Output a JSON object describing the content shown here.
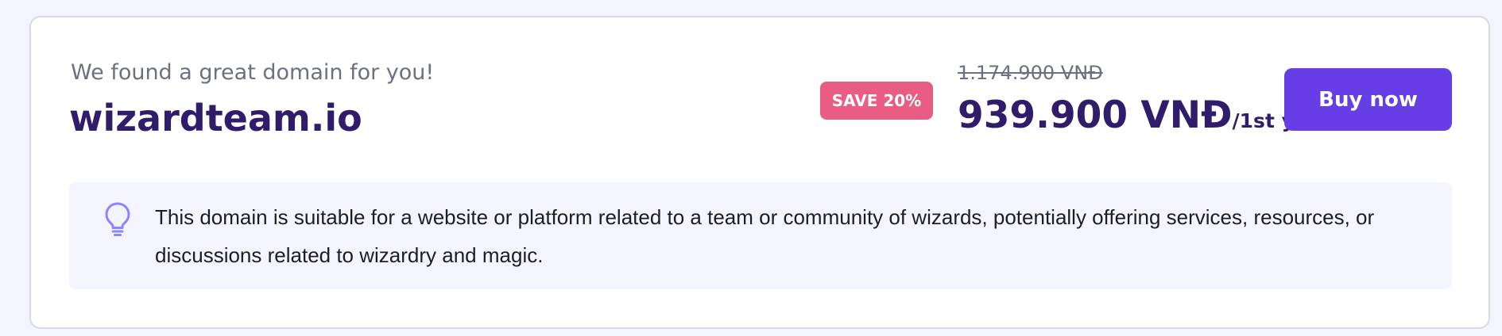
{
  "card": {
    "subtitle": "We found a great domain for you!",
    "domain": "wizardteam.io"
  },
  "pricing": {
    "save_badge": "SAVE 20%",
    "old_price": "1.174.900 VNĐ",
    "price": "939.900 VNĐ",
    "price_suffix": "/1st yr",
    "buy_label": "Buy now"
  },
  "info": {
    "icon": "lightbulb-icon",
    "text": "This domain is suitable for a website or platform related to a team or community of wizards, potentially offering services, resources, or discussions related to wizardry and magic."
  },
  "colors": {
    "page_background": "#f4f4fe",
    "brand_dark": "#2f1c6a",
    "primary": "#673de6",
    "sale": "#e95c83",
    "icon": "#8c85ff"
  }
}
